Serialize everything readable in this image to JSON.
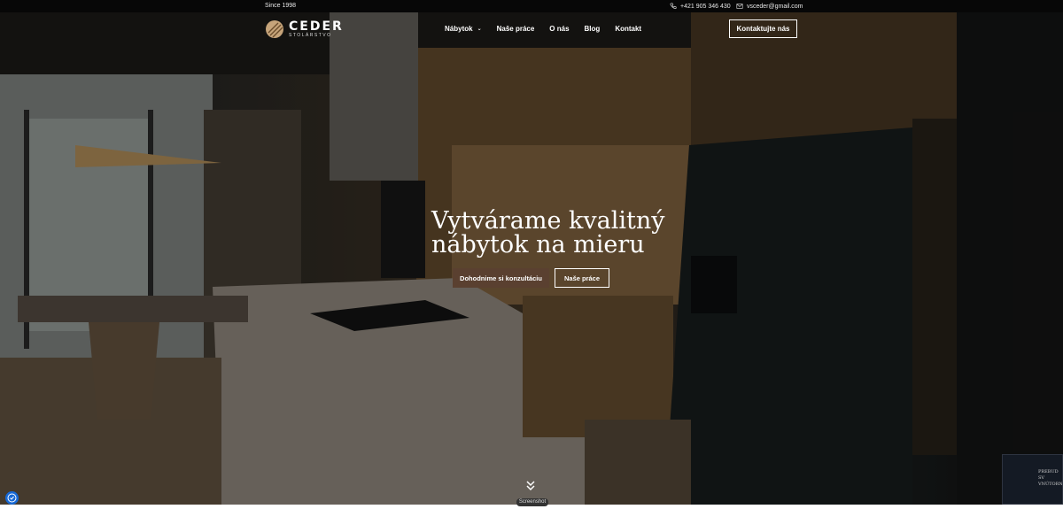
{
  "topbar": {
    "since": "Since 1998",
    "phone": "+421 905 346 430",
    "email": "vsceder@gmail.com",
    "icons": [
      "phone-icon",
      "mail-icon"
    ]
  },
  "brand": {
    "name": "CEDER",
    "tagline": "STOLÁRSTVO"
  },
  "nav": {
    "items": [
      {
        "label": "Nábytok",
        "has_dropdown": true
      },
      {
        "label": "Naše práce"
      },
      {
        "label": "O nás"
      },
      {
        "label": "Blog"
      },
      {
        "label": "Kontakt"
      }
    ],
    "cta": "Kontaktujte nás"
  },
  "hero": {
    "headline_line1": "Vytvárame kvalitný",
    "headline_line2": "nábytok na mieru",
    "primary_button": "Dohodnime si konzultáciu",
    "secondary_button": "Naše práce",
    "accent_color": "#5a4030"
  },
  "widgets": {
    "screenshot_label": "Screenshot",
    "popup_line1": "PREBUD SV",
    "popup_line2": "VNÚTORNÚ"
  }
}
